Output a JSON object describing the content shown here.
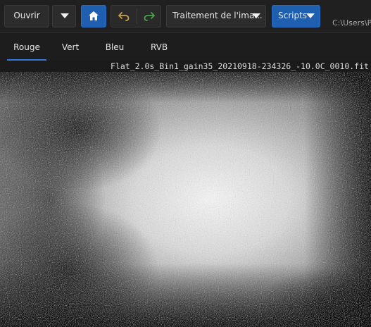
{
  "toolbar": {
    "open_label": "Ouvrir",
    "open_menu_icon": "chevron-down-icon",
    "home_icon": "home-icon",
    "undo_icon": "undo-icon",
    "redo_icon": "redo-icon",
    "process_label": "Traitement de l'ima...",
    "scripts_label": "Scripts",
    "path_text": "C:\\Users\\P"
  },
  "tabs": [
    {
      "label": "Rouge",
      "active": true
    },
    {
      "label": "Vert",
      "active": false
    },
    {
      "label": "Bleu",
      "active": false
    },
    {
      "label": "RVB",
      "active": false
    }
  ],
  "image": {
    "filename": "Flat_2.0s_Bin1_gain35_20210918-234326_-10.0C_0010.fit"
  },
  "colors": {
    "accent": "#2f7ad8",
    "toolbar_bg": "#202020",
    "button_bg": "#2c2c2c",
    "undo_color": "#c7a24a",
    "redo_color": "#4aa24a"
  }
}
